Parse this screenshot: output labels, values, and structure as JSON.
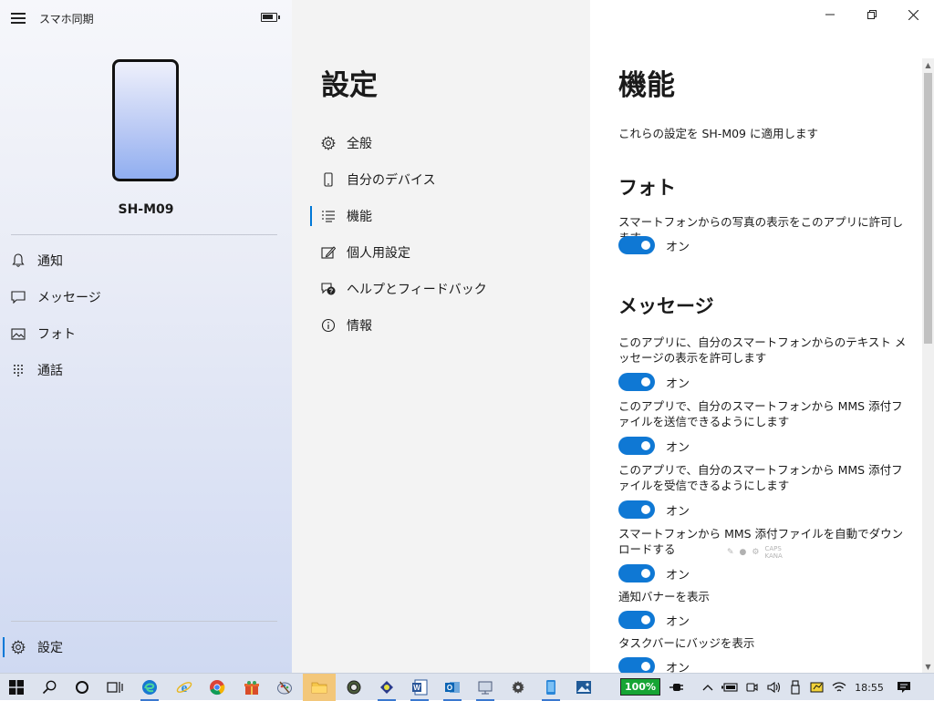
{
  "app": {
    "title": "スマホ同期"
  },
  "device": {
    "name": "SH-M09"
  },
  "left_nav": {
    "items": [
      {
        "label": "通知",
        "icon": "bell-icon"
      },
      {
        "label": "メッセージ",
        "icon": "message-icon"
      },
      {
        "label": "フォト",
        "icon": "photo-icon"
      },
      {
        "label": "通話",
        "icon": "dialpad-icon"
      }
    ],
    "settings": {
      "label": "設定",
      "icon": "gear-icon"
    }
  },
  "settings_pane": {
    "title": "設定",
    "items": [
      {
        "label": "全般",
        "icon": "gear-icon"
      },
      {
        "label": "自分のデバイス",
        "icon": "phone-icon"
      },
      {
        "label": "機能",
        "icon": "list-icon",
        "selected": true
      },
      {
        "label": "個人用設定",
        "icon": "personalize-icon"
      },
      {
        "label": "ヘルプとフィードバック",
        "icon": "help-chat-icon"
      },
      {
        "label": "情報",
        "icon": "info-icon"
      }
    ]
  },
  "features": {
    "title": "機能",
    "apply_text": "これらの設定を SH-M09 に適用します",
    "photo": {
      "title": "フォト",
      "desc": "スマートフォンからの写真の表示をこのアプリに許可します。",
      "state": "オン"
    },
    "messages": {
      "title": "メッセージ",
      "settings": [
        {
          "desc": "このアプリに、自分のスマートフォンからのテキスト メッセージの表示を許可します",
          "state": "オン"
        },
        {
          "desc": "このアプリで、自分のスマートフォンから MMS 添付ファイルを送信できるようにします",
          "state": "オン"
        },
        {
          "desc": "このアプリで、自分のスマートフォンから MMS 添付ファイルを受信できるようにします",
          "state": "オン"
        },
        {
          "desc": "スマートフォンから MMS 添付ファイルを自動でダウンロードする",
          "state": "オン"
        },
        {
          "desc": "通知バナーを表示",
          "state": "オン"
        },
        {
          "desc": "タスクバーにバッジを表示",
          "state": "オン"
        }
      ]
    }
  },
  "ime_bar": {
    "caps": "CAPS",
    "kana": "KANA"
  },
  "taskbar": {
    "battery_percent": "100%",
    "clock": "18:55",
    "accent": "#0078d7"
  }
}
